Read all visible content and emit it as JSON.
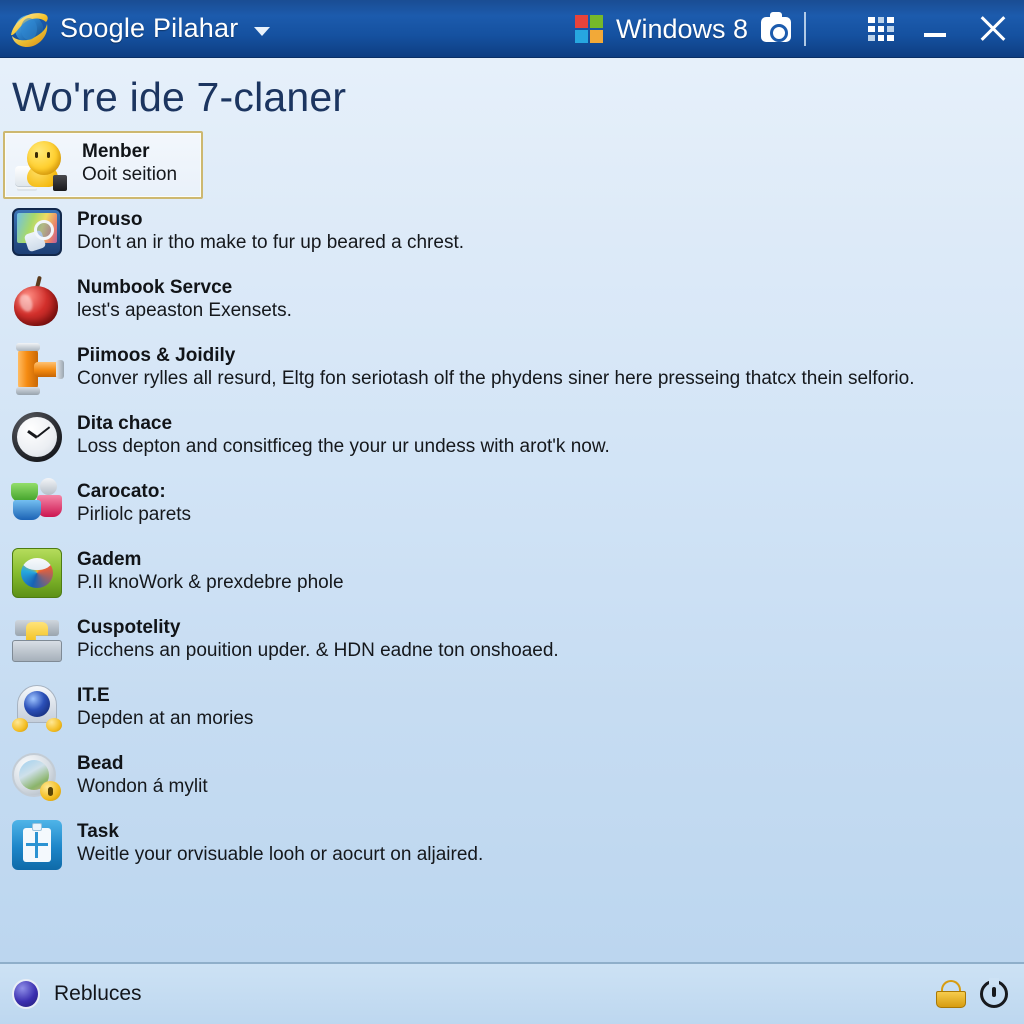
{
  "titlebar": {
    "logo_icon": "internet-explorer-icon",
    "title": "Soogle Pilahar",
    "dropdown_icon": "chevron-down-icon",
    "windows_logo_icon": "windows-logo-icon",
    "windows_label": "Windows 8",
    "camera_icon": "camera-icon",
    "grid_icon": "grid-apps-icon",
    "minimize_icon": "minimize-icon",
    "close_icon": "close-icon"
  },
  "page": {
    "heading": "Wo're ide 7-claner"
  },
  "list": {
    "items": [
      {
        "icon": "smiley-helper-icon",
        "title": "Menber",
        "desc": "Ooit seition",
        "selected": true
      },
      {
        "icon": "media-gallery-icon",
        "title": "Prouso",
        "desc": "Don't an ir tho make to fur up beared a chrest.",
        "selected": false
      },
      {
        "icon": "apple-icon",
        "title": "Numbook Servce",
        "desc": "lest's apeaston Exensets.",
        "selected": false
      },
      {
        "icon": "pipe-valve-icon",
        "title": "Piimoos & Joidily",
        "desc": "Conver rylles all resurd, Eltg fon seriotash olf the phydens siner here presseing thatcx thein selforio.",
        "selected": false
      },
      {
        "icon": "clock-icon",
        "title": "Dita chace",
        "desc": "Loss depton and consitficeg the your ur undess with arot'k now.",
        "selected": false
      },
      {
        "icon": "people-group-icon",
        "title": "Carocato:",
        "desc": "Pirliolc parets",
        "selected": false
      },
      {
        "icon": "green-orb-icon",
        "title": "Gadem",
        "desc": "P.II knoWork & prexdebre phole",
        "selected": false
      },
      {
        "icon": "drawer-document-icon",
        "title": "Cuspotelity",
        "desc": "Picchens an pouition upder. & HDN eadne ton onshoaed.",
        "selected": false
      },
      {
        "icon": "globe-lamp-icon",
        "title": "IT.E",
        "desc": "Depden at an mories",
        "selected": false
      },
      {
        "icon": "coin-lock-icon",
        "title": "Bead",
        "desc": "Wondon á mylit",
        "selected": false
      },
      {
        "icon": "clipboard-task-icon",
        "title": "Task",
        "desc": "Weitle your orvisuable looh or aocurt on aljaired.",
        "selected": false
      }
    ]
  },
  "statusbar": {
    "orb_icon": "purple-orb-icon",
    "label": "Rebluces",
    "basket_icon": "basket-icon",
    "power_icon": "power-icon"
  },
  "colors": {
    "titlebar_blue": "#1c5bad",
    "heading_navy": "#1c3560",
    "selected_border": "#cdb870",
    "status_bg": "#c5dcf1"
  }
}
